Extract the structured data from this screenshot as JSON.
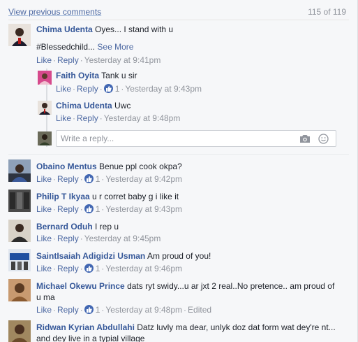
{
  "header": {
    "view_previous": "View previous comments",
    "count": "115 of 119"
  },
  "actions": {
    "like": "Like",
    "reply": "Reply",
    "sep": "·",
    "edited": "Edited"
  },
  "reply_box": {
    "placeholder": "Write a reply..."
  },
  "thread": {
    "main": {
      "name": "Chima Udenta",
      "text": "Oyes... I stand with u",
      "hashtag": "#Blessedchild...",
      "see_more": "See More",
      "time": "Yesterday at 9:41pm"
    },
    "replies": [
      {
        "name": "Faith Oyita",
        "text": "Tank u sir",
        "likes": "1",
        "time": "Yesterday at 9:43pm"
      },
      {
        "name": "Chima Udenta",
        "text": "Uwc",
        "likes": "",
        "time": "Yesterday at 9:48pm"
      }
    ]
  },
  "comments": [
    {
      "name": "Obaino Mentus",
      "text": "Benue ppl cook okpa?",
      "text2": "",
      "likes": "1",
      "time": "Yesterday at 9:42pm",
      "edited": ""
    },
    {
      "name": "Philip T Ikyaa",
      "text": "u r corret baby g i like it",
      "text2": "",
      "likes": "1",
      "time": "Yesterday at 9:43pm",
      "edited": ""
    },
    {
      "name": "Bernard Oduh",
      "text": "I rep u",
      "text2": "",
      "likes": "",
      "time": "Yesterday at 9:45pm",
      "edited": ""
    },
    {
      "name": "SaintIsaiah Adigidzi Usman",
      "text": "Am proud of you!",
      "text2": "",
      "likes": "1",
      "time": "Yesterday at 9:46pm",
      "edited": ""
    },
    {
      "name": "Michael Okewu Prince",
      "text": "dats ryt swidy...u ar jxt 2 real..No pretence.. am proud of",
      "text2": "u ma",
      "likes": "1",
      "time": "Yesterday at 9:48pm",
      "edited": "Edited"
    },
    {
      "name": "Ridwan Kyrian Abdullahi",
      "text": "Datz luvly ma dear, unlyk doz dat form wat dey're nt...",
      "text2": "and dey live in a typial village",
      "likes": "",
      "time": "",
      "edited": ""
    }
  ],
  "colors": {
    "link": "#365899",
    "meta": "#90949c",
    "like_blue": "#4267b2",
    "bg": "#f6f7f9"
  },
  "icons": [
    "camera-icon",
    "smiley-icon",
    "like-thumb-icon"
  ]
}
